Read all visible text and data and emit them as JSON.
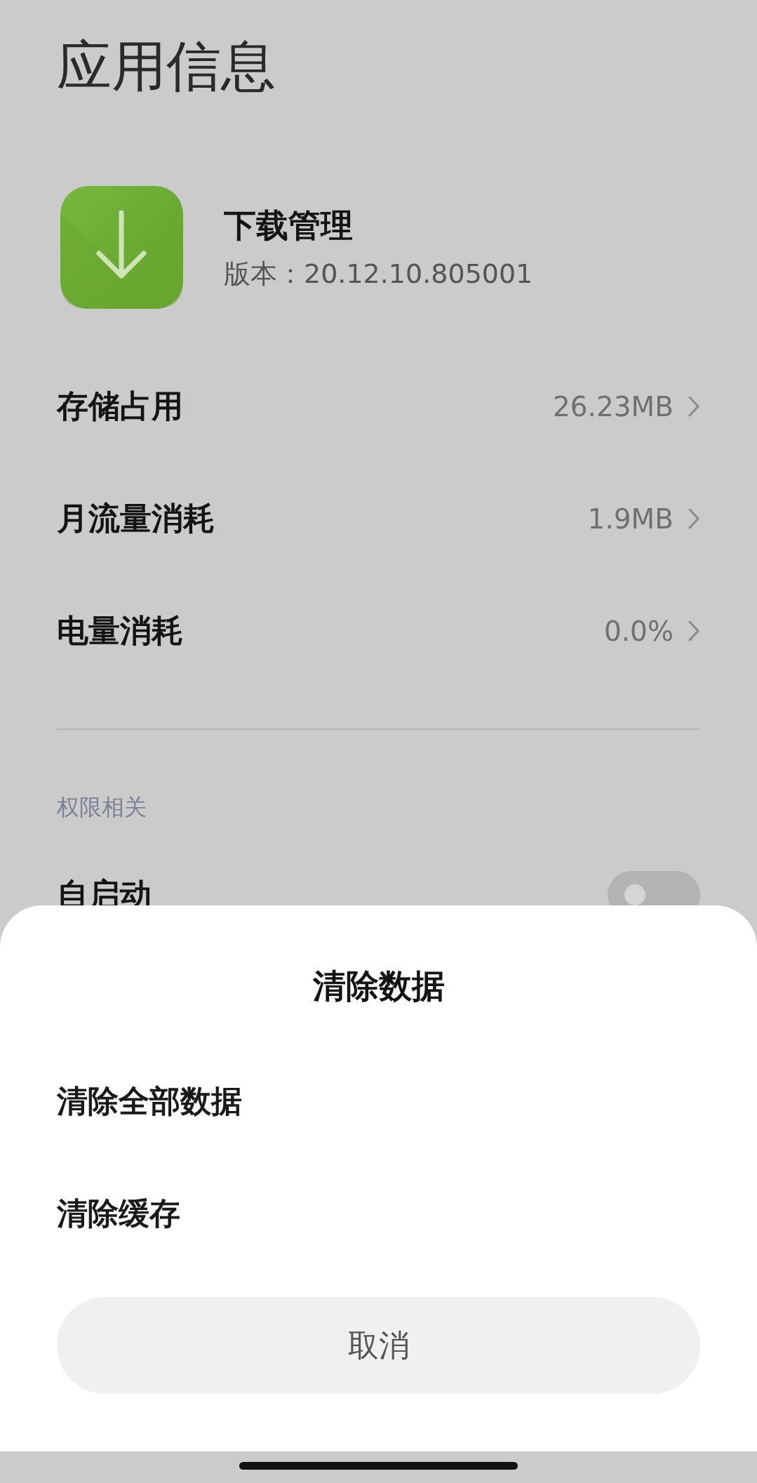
{
  "page": {
    "title": "应用信息"
  },
  "app": {
    "name": "下载管理",
    "version": "版本：20.12.10.805001"
  },
  "rows": [
    {
      "label": "存储占用",
      "value": "26.23MB"
    },
    {
      "label": "月流量消耗",
      "value": "1.9MB"
    },
    {
      "label": "电量消耗",
      "value": "0.0%"
    }
  ],
  "section": {
    "title": "权限相关",
    "items": [
      {
        "label": "自启动",
        "on": false
      }
    ]
  },
  "sheet": {
    "title": "清除数据",
    "options": [
      "清除全部数据",
      "清除缓存"
    ],
    "cancel": "取消"
  }
}
